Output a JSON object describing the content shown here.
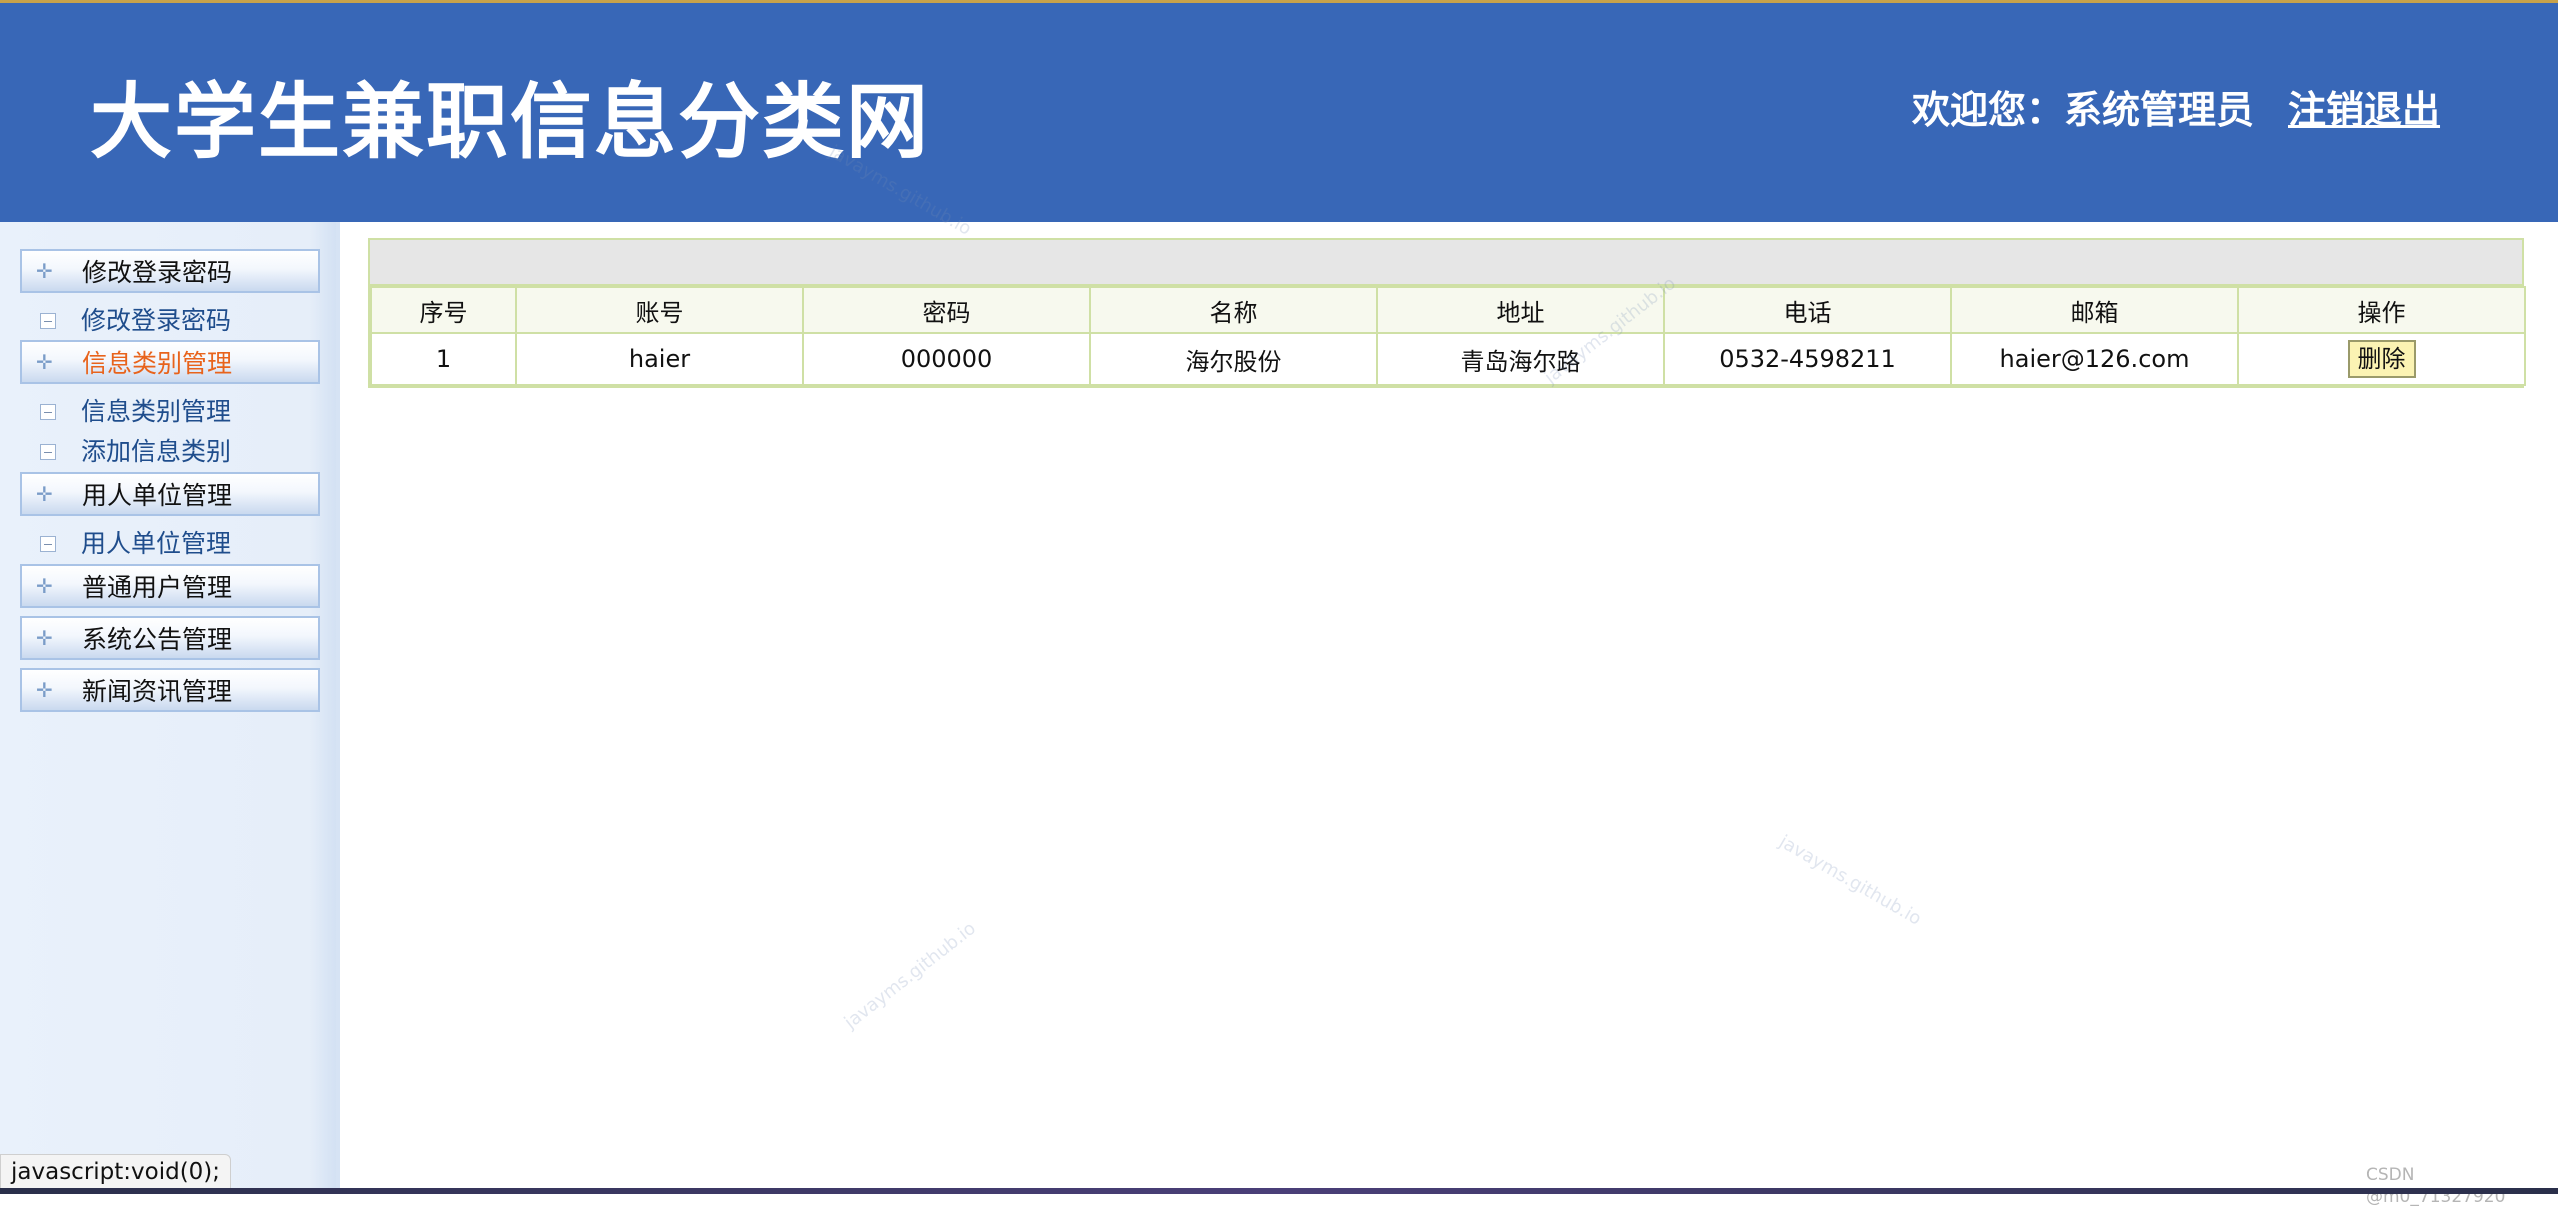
{
  "header": {
    "title": "大学生兼职信息分类网",
    "welcome": "欢迎您：系统管理员",
    "logout_label": "注销退出",
    "bg_color": "#3867b7"
  },
  "sidebar": {
    "groups": [
      {
        "label": "修改登录密码",
        "active": false,
        "items": [
          {
            "label": "修改登录密码"
          }
        ]
      },
      {
        "label": "信息类别管理",
        "active": true,
        "items": [
          {
            "label": "信息类别管理"
          },
          {
            "label": "添加信息类别"
          }
        ]
      },
      {
        "label": "用人单位管理",
        "active": false,
        "items": [
          {
            "label": "用人单位管理"
          }
        ]
      },
      {
        "label": "普通用户管理",
        "active": false,
        "items": []
      },
      {
        "label": "系统公告管理",
        "active": false,
        "items": []
      },
      {
        "label": "新闻资讯管理",
        "active": false,
        "items": []
      }
    ],
    "plus_icon": "plus-icon",
    "minus_icon": "minus-box-icon",
    "active_color": "#e8631c"
  },
  "table": {
    "columns": [
      "序号",
      "账号",
      "密码",
      "名称",
      "地址",
      "电话",
      "邮箱",
      "操作"
    ],
    "rows": [
      {
        "index": "1",
        "account": "haier",
        "password": "000000",
        "name": "海尔股份",
        "address": "青岛海尔路",
        "phone": "0532-4598211",
        "email": "haier@126.com",
        "action": "删除"
      }
    ],
    "border_color": "#cfe0a5"
  },
  "watermarks": [
    "javayms.github.io",
    "javayms.github.io",
    "javayms.github.io",
    "javayms.github.io"
  ],
  "status_bar": {
    "text": "javascript:void(0);"
  },
  "corner_credit": "CSDN @m0_71327920"
}
